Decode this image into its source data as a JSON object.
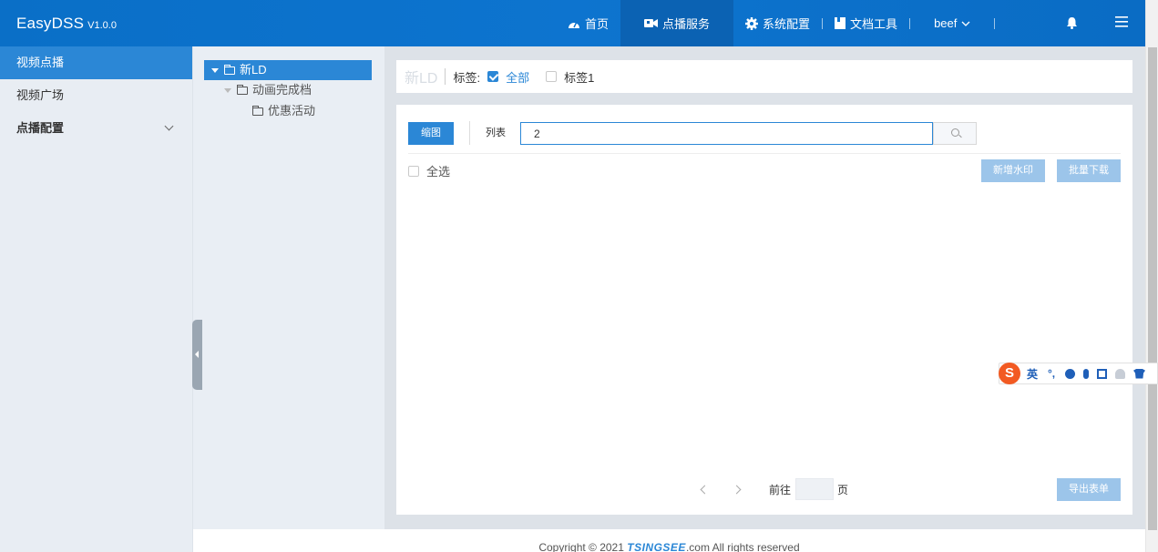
{
  "header": {
    "brand_name": "EasyDSS",
    "brand_version": "V1.0.0",
    "nav": [
      {
        "label": "首页",
        "icon": "dashboard-icon"
      },
      {
        "label": "点播服务",
        "icon": "video-camera-icon",
        "active": true
      },
      {
        "label": "系统配置",
        "icon": "gear-icon"
      },
      {
        "label": "文档工具",
        "icon": "document-icon"
      },
      {
        "label": "beef",
        "icon": "chevron-down-icon"
      }
    ],
    "bell_icon": "bell-icon",
    "menu_icon": "hamburger-icon"
  },
  "sidebar": {
    "items": [
      {
        "label": "视频点播",
        "active": true
      },
      {
        "label": "视频广场"
      },
      {
        "label": "点播配置",
        "bold": true,
        "expandable": true
      }
    ]
  },
  "tree": {
    "nodes": [
      {
        "label": "新LD",
        "selected": true
      },
      {
        "label": "动画完成档"
      },
      {
        "label": "优惠活动"
      }
    ]
  },
  "filter": {
    "title": "新LD",
    "tag_label": "标签:",
    "tags": [
      {
        "label": "全部",
        "checked": true
      },
      {
        "label": "标签1",
        "checked": false
      }
    ]
  },
  "toolbar": {
    "thumbnail_label": "缩图",
    "list_label": "列表",
    "search_value": "2",
    "select_all_label": "全选",
    "add_watermark_label": "新增水印",
    "batch_download_label": "批量下载"
  },
  "pager": {
    "goto_label": "前往",
    "page_suffix": "页",
    "export_label": "导出表单"
  },
  "footer": {
    "prefix": "Copyright © 2021 ",
    "brand": "TSINGSEE",
    "suffix": ".com All rights reserved"
  },
  "ime": {
    "logo": "S",
    "lang": "英",
    "punct": "°,"
  },
  "colors": {
    "primary": "#2b87d6",
    "header": "#0d74cf",
    "header_active": "#0b62b3",
    "disabled_button": "#9cc5ea",
    "ime_logo": "#f25a22"
  }
}
